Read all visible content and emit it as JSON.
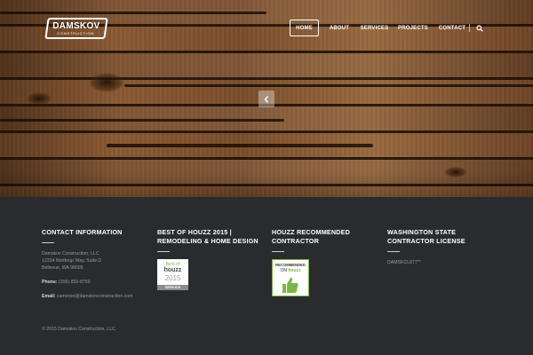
{
  "logo": {
    "brand": "DAMSKOV",
    "tagline": "CONSTRUCTION"
  },
  "nav": {
    "items": [
      "HOME",
      "ABOUT",
      "SERVICES",
      "PROJECTS",
      "CONTACT"
    ],
    "active": "HOME",
    "search_icon": "search-icon"
  },
  "slider": {
    "arrow_icon": "chevron-left-icon"
  },
  "colors": {
    "footer_bg": "#2a2b2e",
    "houzz_green": "#7ab648",
    "text_muted": "#9a9a9a"
  },
  "footer": {
    "contact": {
      "heading": "CONTACT INFORMATION",
      "company": "Damskov Construction, LLC",
      "street": "12334 Northrup Way, Suite D",
      "city": "Bellevue, WA 98005",
      "phone_label": "Phone:",
      "phone": "(206) 850-8759",
      "email_label": "Email:",
      "email": "cameron@damskovconstruction.com"
    },
    "houzz_best": {
      "heading": "BEST OF HOUZZ 2015 | REMODELING & HOME DESIGN",
      "badge_best": "Best of",
      "badge_brand": "houzz",
      "badge_year": "2015",
      "badge_service": "SERVICE"
    },
    "houzz_recommended": {
      "heading": "HOUZZ RECOMMENDED CONTRACTOR",
      "badge_line1": "RECOMMENDED",
      "badge_on": "ON",
      "badge_brand": "houzz"
    },
    "license": {
      "heading": "WASHINGTON STATE CONTRACTOR LICENSE",
      "number": "DAMSKCL877**"
    },
    "copyright": "© 2015 Damskov Construction, LLC"
  }
}
